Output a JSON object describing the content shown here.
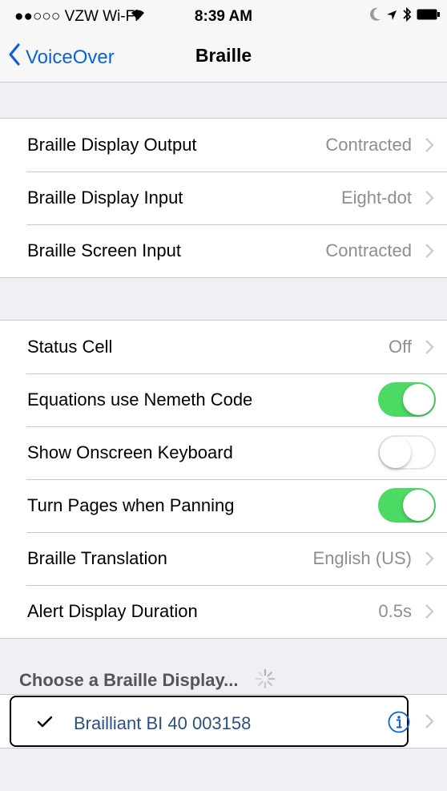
{
  "status_bar": {
    "carrier": "●●○○○ VZW Wi-Fi",
    "time": "8:39 AM"
  },
  "nav": {
    "back_label": "VoiceOver",
    "title": "Braille"
  },
  "group1": [
    {
      "label": "Braille Display Output",
      "value": "Contracted"
    },
    {
      "label": "Braille Display Input",
      "value": "Eight-dot"
    },
    {
      "label": "Braille Screen Input",
      "value": "Contracted"
    }
  ],
  "group2": {
    "status_cell": {
      "label": "Status Cell",
      "value": "Off"
    },
    "nemeth": {
      "label": "Equations use Nemeth Code",
      "on": true
    },
    "keyboard": {
      "label": "Show Onscreen Keyboard",
      "on": false
    },
    "turn_pages": {
      "label": "Turn Pages when Panning",
      "on": true
    },
    "translation": {
      "label": "Braille Translation",
      "value": "English (US)"
    },
    "alert": {
      "label": "Alert Display Duration",
      "value": "0.5s"
    }
  },
  "displays": {
    "header": "Choose a Braille Display...",
    "items": [
      {
        "name": "Brailliant BI 40 003158",
        "selected": true
      }
    ]
  },
  "colors": {
    "accent": "#0a63d6",
    "switch_on": "#4cd964",
    "background": "#efeff4"
  }
}
